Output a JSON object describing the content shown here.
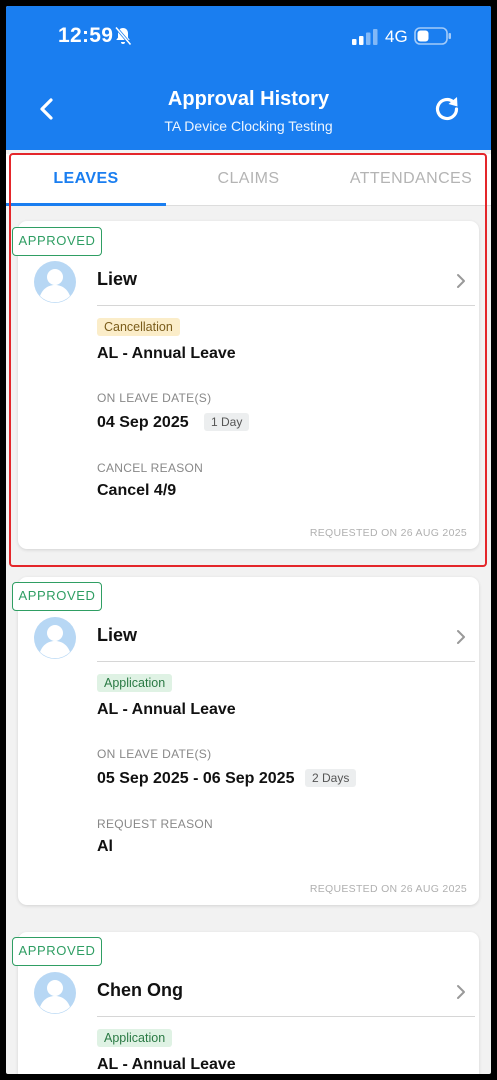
{
  "status_bar": {
    "time": "12:59",
    "network": "4G"
  },
  "header": {
    "title": "Approval History",
    "subtitle": "TA Device Clocking Testing"
  },
  "tabs": [
    {
      "label": "LEAVES",
      "active": true
    },
    {
      "label": "CLAIMS",
      "active": false
    },
    {
      "label": "ATTENDANCES",
      "active": false
    }
  ],
  "cards": [
    {
      "status": "APPROVED",
      "name": "Liew",
      "tag": "Cancellation",
      "leave_type": "AL - Annual Leave",
      "date_label": "ON LEAVE DATE(S)",
      "date": "04 Sep 2025",
      "days": "1 Day",
      "reason_label": "CANCEL REASON",
      "reason": "Cancel 4/9",
      "requested": "REQUESTED ON 26 AUG 2025"
    },
    {
      "status": "APPROVED",
      "name": "Liew",
      "tag": "Application",
      "leave_type": "AL - Annual Leave",
      "date_label": "ON LEAVE DATE(S)",
      "date": "05 Sep 2025 - 06 Sep 2025",
      "days": "2 Days",
      "reason_label": "REQUEST REASON",
      "reason": "Al",
      "requested": "REQUESTED ON 26 AUG 2025"
    },
    {
      "status": "APPROVED",
      "name": "Chen Ong",
      "tag": "Application",
      "leave_type": "AL - Annual Leave"
    }
  ],
  "colors": {
    "primary": "#1a7ef0",
    "approved": "#2f9e63",
    "highlight": "#e4262a"
  },
  "icons": [
    "bell-slash-icon",
    "signal-icon",
    "battery-icon",
    "back-arrow-icon",
    "refresh-icon",
    "avatar-icon",
    "chevron-right-icon"
  ]
}
